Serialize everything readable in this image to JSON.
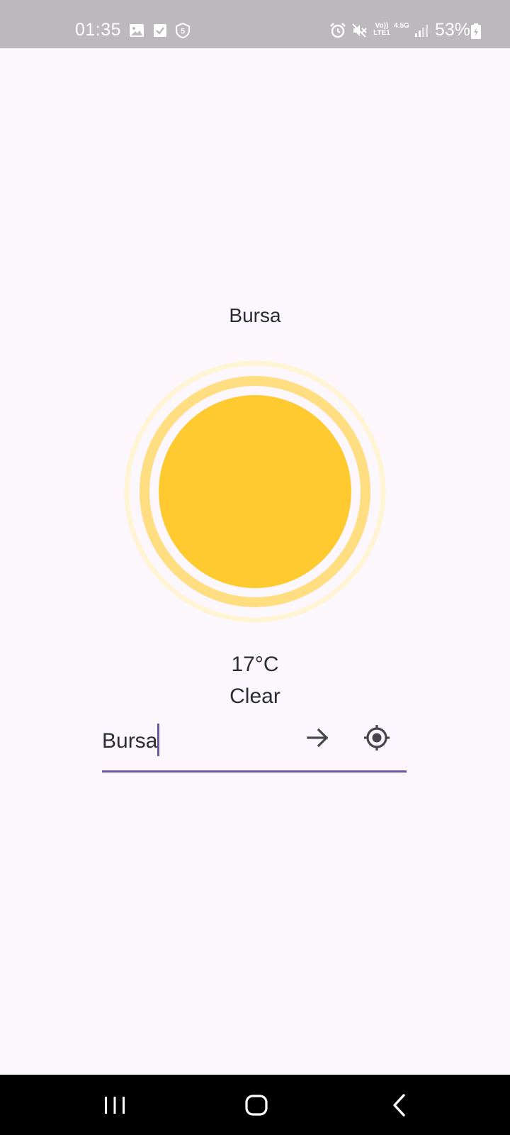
{
  "status_bar": {
    "time": "01:35",
    "network_top": "Vo))",
    "network_bottom": "LTE1",
    "network_gen": "4.5G",
    "battery": "53%",
    "icons": [
      "gallery-icon",
      "checkbox-icon",
      "shield-5-icon",
      "alarm-icon",
      "mute-icon",
      "signal-icon",
      "battery-charging-icon"
    ]
  },
  "weather": {
    "city": "Bursa",
    "temperature": "17°C",
    "condition": "Clear",
    "icon": "sun-icon",
    "sun_color": "#ffca30"
  },
  "search": {
    "value": "Bursa",
    "submit_icon": "arrow-right-icon",
    "location_icon": "my-location-icon",
    "accent_color": "#6a55a1"
  },
  "nav_bar": {
    "buttons": [
      "recents-icon",
      "home-icon",
      "back-icon"
    ]
  }
}
